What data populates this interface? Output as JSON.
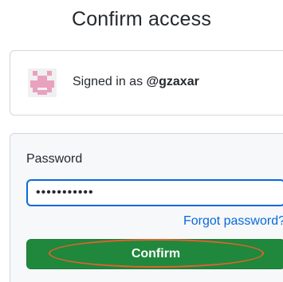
{
  "page": {
    "title": "Confirm access"
  },
  "account": {
    "signed_in_prefix": "Signed in as ",
    "username": "@gzaxar"
  },
  "form": {
    "password_label": "Password",
    "password_value": "•••••••••••",
    "forgot_link": "Forgot password?",
    "confirm_label": "Confirm"
  },
  "colors": {
    "accent_blue": "#0969da",
    "button_green": "#1f883d",
    "highlight_ring": "#e0632a",
    "avatar_pink": "#e8a2bd"
  }
}
